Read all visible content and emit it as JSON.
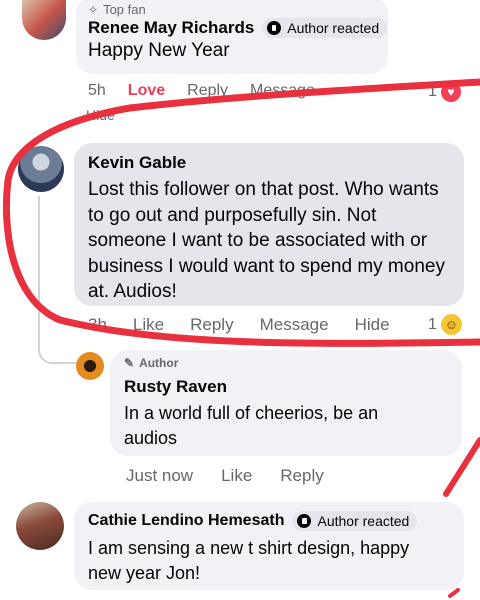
{
  "comments": [
    {
      "top_fan_label": "Top fan",
      "name": "Renee May Richards",
      "author_badge": "Author reacted",
      "text": "Happy New Year",
      "time": "5h",
      "actions": [
        "Love",
        "Reply",
        "Message",
        "Hide"
      ],
      "reaction_count": "1",
      "reaction_icon": "heart-icon",
      "avatar_color": "#c9574a"
    },
    {
      "name": "Kevin Gable",
      "text": "Lost this follower on that post. Who wants to go out and purposefully sin. Not someone I want to be associated with or business I would want to spend my money at. Audios!",
      "time": "3h",
      "actions": [
        "Like",
        "Reply",
        "Message",
        "Hide"
      ],
      "reaction_count": "1",
      "reaction_icon": "laugh-emoji-icon",
      "avatar_color": "#6a7d95"
    },
    {
      "author_label": "Author",
      "name": "Rusty Raven",
      "text": "In a world full of cheerios, be an audios",
      "time": "Just now",
      "actions": [
        "Like",
        "Reply"
      ],
      "avatar_color": "#e58a1f"
    },
    {
      "name": "Cathie Lendino Hemesath",
      "author_badge": "Author reacted",
      "text": "I am sensing a new t shirt design, happy new year Jon!",
      "avatar_color": "#8a4a3a"
    }
  ],
  "colors": {
    "annotation_red": "#e8303f",
    "love_red": "#f33e58",
    "secondary_text": "#65676b",
    "bubble_dark": "#e4e6eb",
    "bubble_light": "#f0f2f5"
  }
}
